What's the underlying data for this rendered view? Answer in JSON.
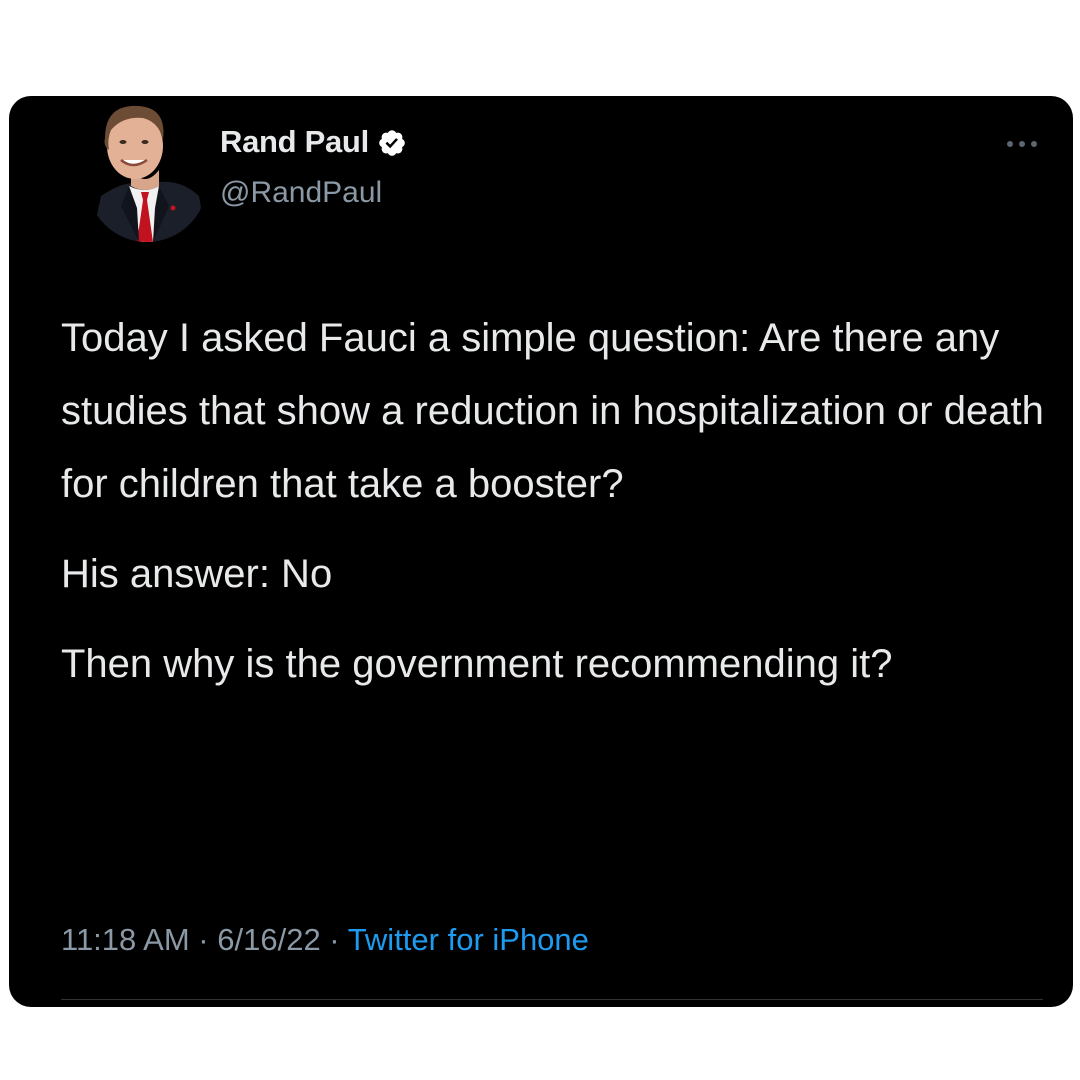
{
  "tweet": {
    "author": {
      "display_name": "Rand Paul",
      "handle": "@RandPaul",
      "verified": true
    },
    "paragraphs": [
      "Today I asked Fauci a simple question: Are there any studies that show a reduction in hospitalization or death for children that take a booster?",
      "His answer: No",
      "Then why is the government recommending it?"
    ],
    "time": "11:18 AM",
    "separator": " · ",
    "date": "6/16/22",
    "source": "Twitter for iPhone"
  },
  "colors": {
    "background": "#000000",
    "text": "#e7e9ea",
    "secondary_text": "#8b98a5",
    "link": "#1d9bf0",
    "verified_badge": "#ffffff"
  },
  "icons": {
    "verified": "verified-badge-icon",
    "more": "more-options-icon"
  }
}
